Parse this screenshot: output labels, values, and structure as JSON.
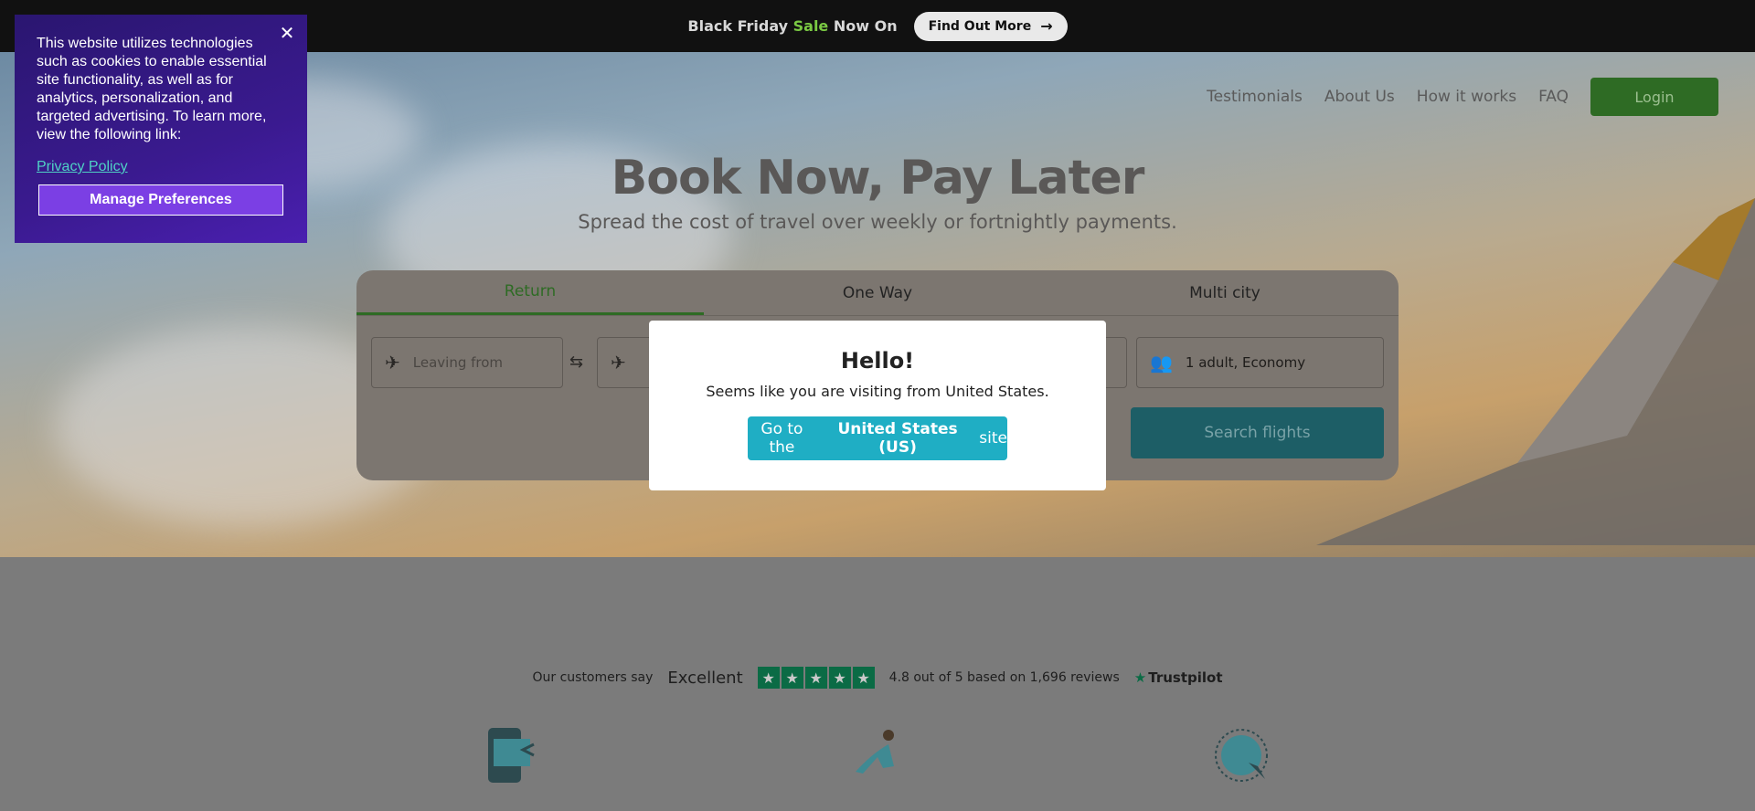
{
  "promo": {
    "text_before": "Black Friday ",
    "text_sale": "Sale",
    "text_after": " Now On",
    "button_label": "Find Out More"
  },
  "nav": {
    "items": [
      "Testimonials",
      "About Us",
      "How it works",
      "FAQ"
    ],
    "login_label": "Login"
  },
  "hero": {
    "title": "Book Now, Pay Later",
    "subtitle": "Spread the cost of travel over weekly or fortnightly payments."
  },
  "search": {
    "tabs": [
      "Return",
      "One Way",
      "Multi city"
    ],
    "active_tab": "Return",
    "leaving_placeholder": "Leaving from",
    "passengers_value": "1 adult, Economy",
    "search_label": "Search flights"
  },
  "trustpilot": {
    "say": "Our customers say",
    "rating_word": "Excellent",
    "rating_text": "4.8 out of 5 based on 1,696 reviews",
    "logo_text": "Trustpilot",
    "stars": 5
  },
  "modal": {
    "title": "Hello!",
    "text": "Seems like you are visiting from United States.",
    "btn_prefix": "Go to the",
    "btn_bold": "United States (US)",
    "btn_suffix": "site"
  },
  "cookie": {
    "text": "This website utilizes technologies such as cookies to enable essential site functionality, as well as for analytics, personalization, and targeted advertising. To learn more, view the following link:",
    "link": "Privacy Policy",
    "button": "Manage Preferences"
  },
  "colors": {
    "brand_green": "#2e6b24",
    "sale_green": "#7ac943",
    "modal_button": "#1faec4",
    "cookie_bg": "#3a1a8f",
    "cookie_button": "#7b3fe4",
    "trustpilot_green": "#0b6b45"
  },
  "icons": {
    "promo_button": "arrow-right-icon",
    "departure": "plane-takeoff-icon",
    "swap": "swap-arrows-icon",
    "arrival": "plane-landing-icon",
    "passengers": "users-icon",
    "cookie_close": "close-icon"
  }
}
